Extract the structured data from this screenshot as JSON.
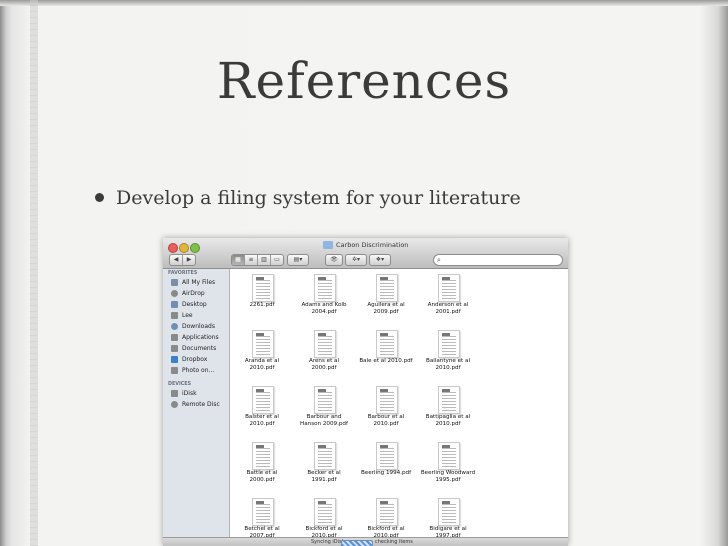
{
  "slide": {
    "title": "References",
    "bullets": [
      "Develop a filing system for your literature"
    ]
  },
  "finder": {
    "window_title": "Carbon Discrimination",
    "sidebar": {
      "sections": [
        {
          "heading": "FAVORITES",
          "items": [
            {
              "label": "All My Files",
              "icon": "all-files-icon",
              "color": "#7d8fa6"
            },
            {
              "label": "AirDrop",
              "icon": "airdrop-icon",
              "color": "#8a8a8a"
            },
            {
              "label": "Desktop",
              "icon": "desktop-icon",
              "color": "#6f8fb5"
            },
            {
              "label": "Lee",
              "icon": "home-icon",
              "color": "#8a8a8a"
            },
            {
              "label": "Downloads",
              "icon": "downloads-icon",
              "color": "#6f8fb5"
            },
            {
              "label": "Applications",
              "icon": "applications-icon",
              "color": "#8a8a8a"
            },
            {
              "label": "Documents",
              "icon": "documents-icon",
              "color": "#8a8a8a"
            },
            {
              "label": "Dropbox",
              "icon": "dropbox-icon",
              "color": "#3d80c9"
            },
            {
              "label": "Photo on...",
              "icon": "photo-icon",
              "color": "#8a8a8a"
            }
          ]
        },
        {
          "heading": "DEVICES",
          "items": [
            {
              "label": "iDisk",
              "icon": "idisk-icon",
              "color": "#8a8a8a"
            },
            {
              "label": "Remote Disc",
              "icon": "remote-disc-icon",
              "color": "#8a8a8a"
            }
          ]
        }
      ]
    },
    "files": [
      "2261.pdf",
      "Adams and Kolb\n2004.pdf",
      "Aguilera et al\n2009.pdf",
      "Anderson et al\n2001.pdf",
      "Aranda et al\n2010.pdf",
      "Arens et al\n2000.pdf",
      "Bale et al 2010.pdf",
      "Ballantyne et al\n2010.pdf",
      "Balster et al\n2010.pdf",
      "Barbour and\nHanson 2009.pdf",
      "Barbour et al\n2010.pdf",
      "Battipaglia et al\n2010.pdf",
      "Battle et al\n2000.pdf",
      "Becker et al\n1991.pdf",
      "Beerling 1994.pdf",
      "Beerling Woodward\n1995.pdf",
      "Betchel et al\n2007.pdf",
      "Bickford et al\n2010.pdf",
      "Bickford et al\n2010.pdf",
      "Bidigare et al\n1997.pdf"
    ],
    "status": {
      "text_left": "Syncing iDisk",
      "text_right": "checking items"
    }
  }
}
